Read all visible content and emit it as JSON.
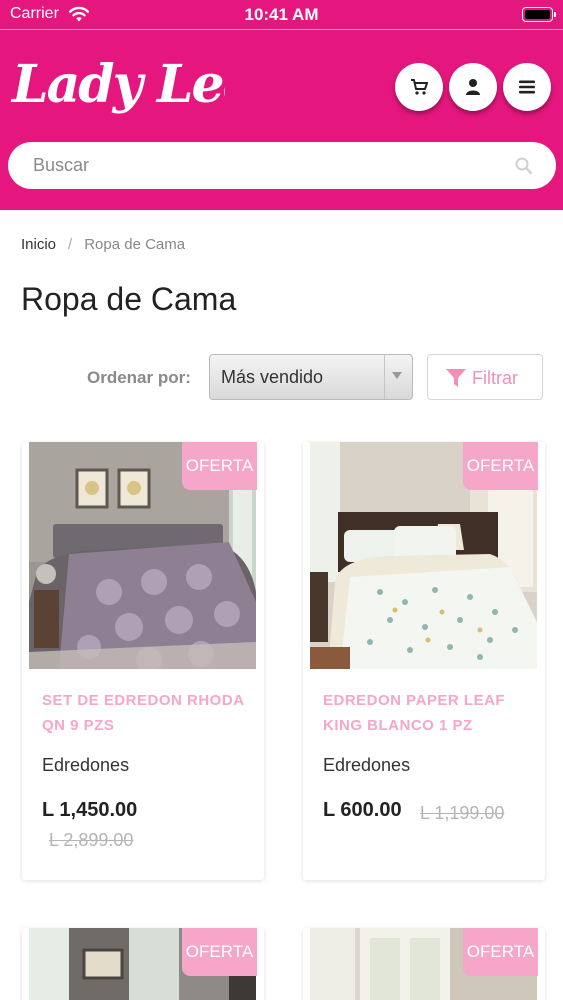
{
  "status_bar": {
    "carrier": "Carrier",
    "time": "10:41 AM"
  },
  "header": {
    "logo_text": "Lady Lee",
    "buttons": [
      "cart-icon",
      "user-icon",
      "menu-icon"
    ],
    "brand_color": "#e5177e",
    "search": {
      "placeholder": "Buscar",
      "value": ""
    }
  },
  "breadcrumb": {
    "home": "Inicio",
    "separator": "/",
    "current": "Ropa de Cama"
  },
  "page_title": "Ropa de Cama",
  "sort": {
    "label": "Ordenar por:",
    "selected": "Más vendido"
  },
  "filter": {
    "label": "Filtrar"
  },
  "products": [
    {
      "badge": "OFERTA",
      "name": "SET DE EDREDON RHODA QN 9 PZS",
      "category": "Edredones",
      "price": "L 1,450.00",
      "old_price": "L 2,899.00",
      "image": "purple-bedding-photo"
    },
    {
      "badge": "OFERTA",
      "name": "EDREDON PAPER LEAF KING BLANCO 1 PZ",
      "category": "Edredones",
      "price": "L 600.00",
      "old_price": "L 1,199.00",
      "image": "leaf-print-bedding-photo"
    },
    {
      "badge": "OFERTA",
      "image": "bedroom-photo"
    },
    {
      "badge": "OFERTA",
      "image": "bedroom-photo"
    }
  ],
  "colors": {
    "badge": "#f5a6c9",
    "product_name": "#f5a6c9",
    "filter_text": "#f28eb8"
  }
}
